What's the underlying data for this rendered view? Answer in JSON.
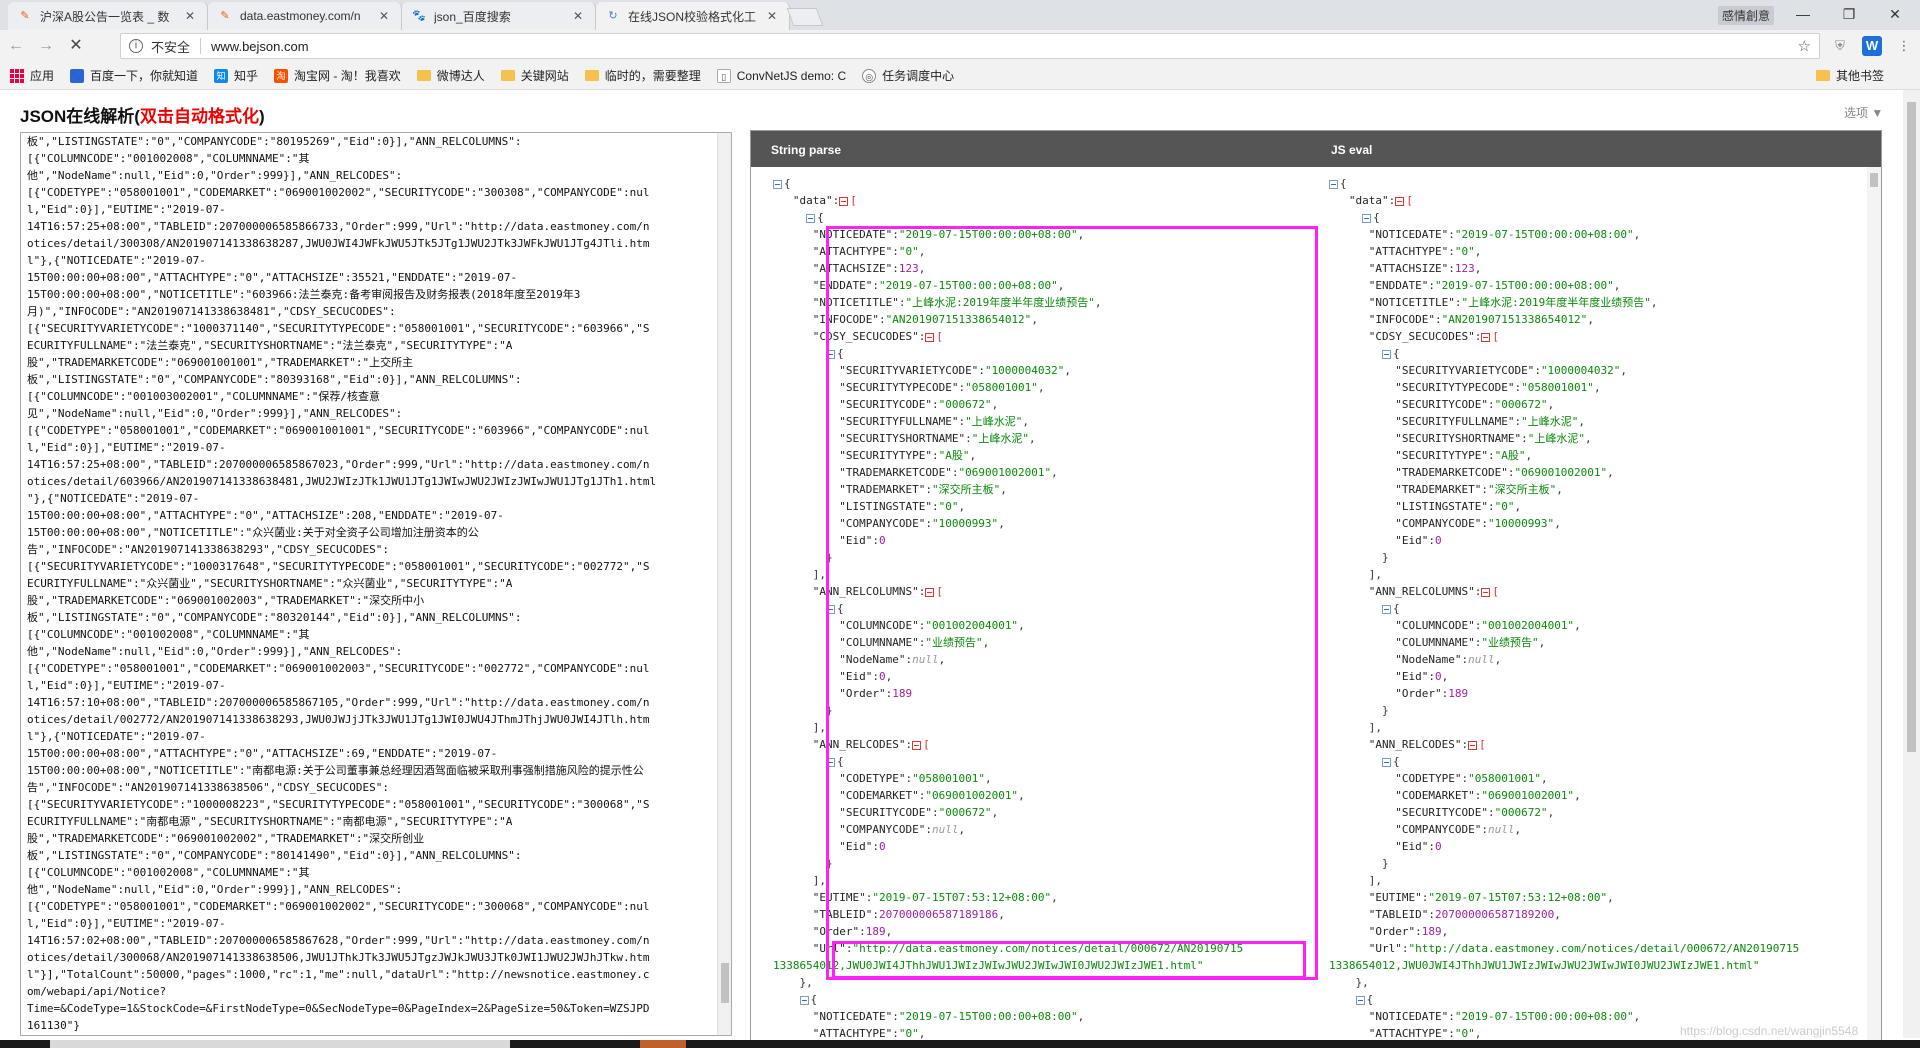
{
  "tabs": [
    {
      "title": "沪深A股公告一览表 _ 数",
      "icon": "eastmoney-icon"
    },
    {
      "title": "data.eastmoney.com/n",
      "icon": "eastmoney-icon"
    },
    {
      "title": "json_百度搜索",
      "icon": "baidu-icon"
    },
    {
      "title": "在线JSON校验格式化工",
      "icon": "loading-icon"
    }
  ],
  "window": {
    "user": "感情創意",
    "minimize": "—",
    "restore": "❐",
    "close": "✕"
  },
  "address": {
    "security": "不安全",
    "url": "www.bejson.com"
  },
  "bookmarks": [
    {
      "label": "应用"
    },
    {
      "label": "百度一下，你就知道"
    },
    {
      "label": "知乎"
    },
    {
      "label": "淘宝网 - 淘！我喜欢"
    },
    {
      "label": "微博达人"
    },
    {
      "label": "关键网站"
    },
    {
      "label": "临时的，需要整理"
    },
    {
      "label": "ConvNetJS demo: C"
    },
    {
      "label": "任务调度中心"
    }
  ],
  "other_bookmarks": "其他书签",
  "page": {
    "title_main": "JSON在线解析(",
    "title_red": "双击自动格式化",
    "title_end": ")",
    "options": "选项 ▼"
  },
  "raw_json_text": "板\",\"LISTINGSTATE\":\"0\",\"COMPANYCODE\":\"80195269\",\"Eid\":0}],\"ANN_RELCOLUMNS\":\n[{\"COLUMNCODE\":\"001002008\",\"COLUMNNAME\":\"其\n他\",\"NodeName\":null,\"Eid\":0,\"Order\":999}],\"ANN_RELCODES\":\n[{\"CODETYPE\":\"058001001\",\"CODEMARKET\":\"069001002002\",\"SECURITYCODE\":\"300308\",\"COMPANYCODE\":nul\nl,\"Eid\":0}],\"EUTIME\":\"2019-07-\n14T16:57:25+08:00\",\"TABLEID\":207000006585866733,\"Order\":999,\"Url\":\"http://data.eastmoney.com/n\notices/detail/300308/AN201907141338638287,JWU0JWI4JWFkJWU5JTk5JTg1JWU2JTk3JWFkJWU1JTg4JTli.htm\nl\"},{\"NOTICEDATE\":\"2019-07-\n15T00:00:00+08:00\",\"ATTACHTYPE\":\"0\",\"ATTACHSIZE\":35521,\"ENDDATE\":\"2019-07-\n15T00:00:00+08:00\",\"NOTICETITLE\":\"603966:法兰泰克:备考审阅报告及财务报表(2018年度至2019年3\n月)\",\"INFOCODE\":\"AN201907141338638481\",\"CDSY_SECUCODES\":\n[{\"SECURITYVARIETYCODE\":\"1000371140\",\"SECURITYTYPECODE\":\"058001001\",\"SECURITYCODE\":\"603966\",\"S\nECURITYFULLNAME\":\"法兰泰克\",\"SECURITYSHORTNAME\":\"法兰泰克\",\"SECURITYTYPE\":\"A\n股\",\"TRADEMARKETCODE\":\"069001001001\",\"TRADEMARKET\":\"上交所主\n板\",\"LISTINGSTATE\":\"0\",\"COMPANYCODE\":\"80393168\",\"Eid\":0}],\"ANN_RELCOLUMNS\":\n[{\"COLUMNCODE\":\"001003002001\",\"COLUMNNAME\":\"保荐/核查意\n见\",\"NodeName\":null,\"Eid\":0,\"Order\":999}],\"ANN_RELCODES\":\n[{\"CODETYPE\":\"058001001\",\"CODEMARKET\":\"069001001001\",\"SECURITYCODE\":\"603966\",\"COMPANYCODE\":nul\nl,\"Eid\":0}],\"EUTIME\":\"2019-07-\n14T16:57:25+08:00\",\"TABLEID\":207000006585867023,\"Order\":999,\"Url\":\"http://data.eastmoney.com/n\notices/detail/603966/AN201907141338638481,JWU2JWIzJTk1JWU1JTg1JWIwJWU2JWIzJWIwJWU1JTg1JTh1.html\n\"},{\"NOTICEDATE\":\"2019-07-\n15T00:00:00+08:00\",\"ATTACHTYPE\":\"0\",\"ATTACHSIZE\":208,\"ENDDATE\":\"2019-07-\n15T00:00:00+08:00\",\"NOTICETITLE\":\"众兴菌业:关于对全资子公司增加注册资本的公\n告\",\"INFOCODE\":\"AN201907141338638293\",\"CDSY_SECUCODES\":\n[{\"SECURITYVARIETYCODE\":\"1000317648\",\"SECURITYTYPECODE\":\"058001001\",\"SECURITYCODE\":\"002772\",\"S\nECURITYFULLNAME\":\"众兴菌业\",\"SECURITYSHORTNAME\":\"众兴菌业\",\"SECURITYTYPE\":\"A\n股\",\"TRADEMARKETCODE\":\"069001002003\",\"TRADEMARKET\":\"深交所中小\n板\",\"LISTINGSTATE\":\"0\",\"COMPANYCODE\":\"80320144\",\"Eid\":0}],\"ANN_RELCOLUMNS\":\n[{\"COLUMNCODE\":\"001002008\",\"COLUMNNAME\":\"其\n他\",\"NodeName\":null,\"Eid\":0,\"Order\":999}],\"ANN_RELCODES\":\n[{\"CODETYPE\":\"058001001\",\"CODEMARKET\":\"069001002003\",\"SECURITYCODE\":\"002772\",\"COMPANYCODE\":nul\nl,\"Eid\":0}],\"EUTIME\":\"2019-07-\n14T16:57:10+08:00\",\"TABLEID\":207000006585867105,\"Order\":999,\"Url\":\"http://data.eastmoney.com/n\notices/detail/002772/AN201907141338638293,JWU0JWJjJTk3JWU1JTg1JWI0JWU4JThmJThjJWU0JWI4JTlh.htm\nl\"},{\"NOTICEDATE\":\"2019-07-\n15T00:00:00+08:00\",\"ATTACHTYPE\":\"0\",\"ATTACHSIZE\":69,\"ENDDATE\":\"2019-07-\n15T00:00:00+08:00\",\"NOTICETITLE\":\"南都电源:关于公司董事兼总经理因酒驾面临被采取刑事强制措施风险的提示性公\n告\",\"INFOCODE\":\"AN201907141338638506\",\"CDSY_SECUCODES\":\n[{\"SECURITYVARIETYCODE\":\"1000008223\",\"SECURITYTYPECODE\":\"058001001\",\"SECURITYCODE\":\"300068\",\"S\nECURITYFULLNAME\":\"南都电源\",\"SECURITYSHORTNAME\":\"南都电源\",\"SECURITYTYPE\":\"A\n股\",\"TRADEMARKETCODE\":\"069001002002\",\"TRADEMARKET\":\"深交所创业\n板\",\"LISTINGSTATE\":\"0\",\"COMPANYCODE\":\"80141490\",\"Eid\":0}],\"ANN_RELCOLUMNS\":\n[{\"COLUMNCODE\":\"001002008\",\"COLUMNNAME\":\"其\n他\",\"NodeName\":null,\"Eid\":0,\"Order\":999}],\"ANN_RELCODES\":\n[{\"CODETYPE\":\"058001001\",\"CODEMARKET\":\"069001002002\",\"SECURITYCODE\":\"300068\",\"COMPANYCODE\":nul\nl,\"Eid\":0}],\"EUTIME\":\"2019-07-\n14T16:57:02+08:00\",\"TABLEID\":207000006585867628,\"Order\":999,\"Url\":\"http://data.eastmoney.com/n\notices/detail/300068/AN201907141338638506,JWU1JThkJTk3JWU5JTgzJWJkJWU3JTk0JWI1JWU2JWJhJTkw.htm\nl\"}],\"TotalCount\":50000,\"pages\":1000,\"rc\":1,\"me\":null,\"dataUrl\":\"http://newsnotice.eastmoney.c\nom/webapi/api/Notice?\nTime=&CodeType=1&StockCode=&FirstNodeType=0&SecNodeType=0&PageIndex=2&PageSize=50&Token=WZSJPD\n161130\"}",
  "panes": {
    "left_header": "String parse",
    "right_header": "JS eval"
  },
  "tree_left": {
    "NOTICEDATE": "\"2019-07-15T00:00:00+08:00\"",
    "ATTACHTYPE": "\"0\"",
    "ATTACHSIZE": "123",
    "ENDDATE": "\"2019-07-15T00:00:00+08:00\"",
    "NOTICETITLE": "\"上峰水泥:2019年度半年度业绩预告\"",
    "INFOCODE": "\"AN201907151338654012\"",
    "SECURITYVARIETYCODE": "\"1000004032\"",
    "SECURITYTYPECODE": "\"058001001\"",
    "SECURITYCODE": "\"000672\"",
    "SECURITYFULLNAME": "\"上峰水泥\"",
    "SECURITYSHORTNAME": "\"上峰水泥\"",
    "SECURITYTYPE": "\"A股\"",
    "TRADEMARKETCODE": "\"069001002001\"",
    "TRADEMARKET": "\"深交所主板\"",
    "LISTINGSTATE": "\"0\"",
    "COMPANYCODE_SEC": "\"10000993\"",
    "Eid0": "0",
    "COLUMNCODE": "\"001002004001\"",
    "COLUMNNAME": "\"业绩预告\"",
    "NodeName": "null",
    "Eid1": "0",
    "Order1": "189",
    "CODETYPE": "\"058001001\"",
    "CODEMARKET": "\"069001002001\"",
    "SECURITYCODE2": "\"000672\"",
    "COMPANYCODE2": "null",
    "Eid2": "0",
    "EUTIME": "\"2019-07-15T07:53:12+08:00\"",
    "TABLEID": "207000006587189186",
    "Order": "189",
    "Url1": "\"http://data.eastmoney.com/notices/detail/000672/AN20190715",
    "Url2": "1338654012,JWU0JWI4JThhJWU1JWIzJWIwJWU2JWIwJWI0JWU2JWIzJWE1.html\"",
    "NEXT_NOTICEDATE": "\"2019-07-15T00:00:00+08:00\"",
    "NEXT_ATTACHTYPE": "\"0\""
  },
  "tree_right": {
    "TABLEID": "207000006587189200",
    "Url1": "\"http://data.eastmoney.com/notices/detail/000672/AN20190715",
    "Url2": "1338654012,JWU0JWI4JThhJWU1JWIzJWIwJWU2JWIwJWI0JWU2JWIzJWE1.html\""
  },
  "watermark": "https://blog.csdn.net/wangjin5548",
  "colors": {
    "highlight": "#ff21f5",
    "string": "#0a8a0a",
    "number": "#a020a0",
    "header": "#555555"
  }
}
